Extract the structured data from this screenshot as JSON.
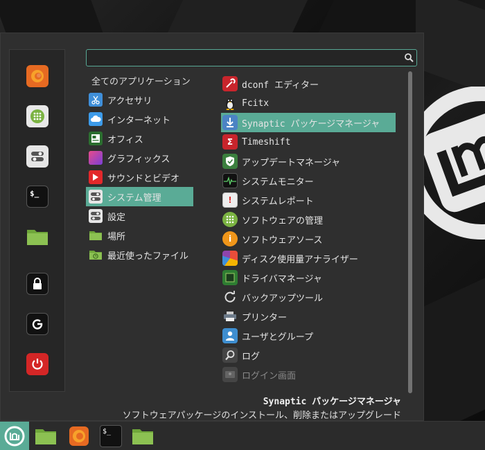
{
  "search": {
    "value": "",
    "placeholder": ""
  },
  "favorites": [
    {
      "name": "firefox"
    },
    {
      "name": "software-manager"
    },
    {
      "name": "system-settings"
    },
    {
      "name": "terminal",
      "glyph": "$_"
    },
    {
      "name": "files"
    },
    {
      "name": "lock-screen"
    },
    {
      "name": "logout"
    },
    {
      "name": "shutdown"
    }
  ],
  "categories": {
    "all_label": "全てのアプリケーション",
    "items": [
      {
        "label": "アクセサリ",
        "icon": "scissors-icon"
      },
      {
        "label": "インターネット",
        "icon": "cloud-icon"
      },
      {
        "label": "オフィス",
        "icon": "office-icon"
      },
      {
        "label": "グラフィックス",
        "icon": "graphics-icon"
      },
      {
        "label": "サウンドとビデオ",
        "icon": "play-icon"
      },
      {
        "label": "システム管理",
        "icon": "system-icon",
        "selected": true
      },
      {
        "label": "設定",
        "icon": "settings-icon"
      },
      {
        "label": "場所",
        "icon": "folder-icon"
      },
      {
        "label": "最近使ったファイル",
        "icon": "recent-folder-icon"
      }
    ]
  },
  "apps": [
    {
      "label": "dconf エディター",
      "icon": "dconf-icon"
    },
    {
      "label": "Fcitx",
      "icon": "penguin-icon"
    },
    {
      "label": "Synaptic パッケージマネージャ",
      "icon": "download-icon",
      "selected": true
    },
    {
      "label": "Timeshift",
      "icon": "timeshift-icon",
      "glyph": "Σ"
    },
    {
      "label": "アップデートマネージャ",
      "icon": "shield-icon"
    },
    {
      "label": "システムモニター",
      "icon": "monitor-icon"
    },
    {
      "label": "システムレポート",
      "icon": "report-icon",
      "glyph": "!"
    },
    {
      "label": "ソフトウェアの管理",
      "icon": "software-icon"
    },
    {
      "label": "ソフトウェアソース",
      "icon": "info-icon",
      "glyph": "i"
    },
    {
      "label": "ディスク使用量アナライザー",
      "icon": "disk-icon"
    },
    {
      "label": "ドライバマネージャ",
      "icon": "chip-icon"
    },
    {
      "label": "バックアップツール",
      "icon": "backup-icon"
    },
    {
      "label": "プリンター",
      "icon": "printer-icon"
    },
    {
      "label": "ユーザとグループ",
      "icon": "user-icon"
    },
    {
      "label": "ログ",
      "icon": "magnifier-icon"
    },
    {
      "label": "ログイン画面",
      "icon": "login-icon",
      "dim": true
    }
  ],
  "description": {
    "title": "Synaptic パッケージマネージャ",
    "text": "ソフトウェアパッケージのインストール、削除またはアップグレード"
  },
  "panel": {
    "terminal_glyph": "$_"
  },
  "colors": {
    "accent": "#5aab96",
    "menu_bg": "#2f2f2f"
  }
}
